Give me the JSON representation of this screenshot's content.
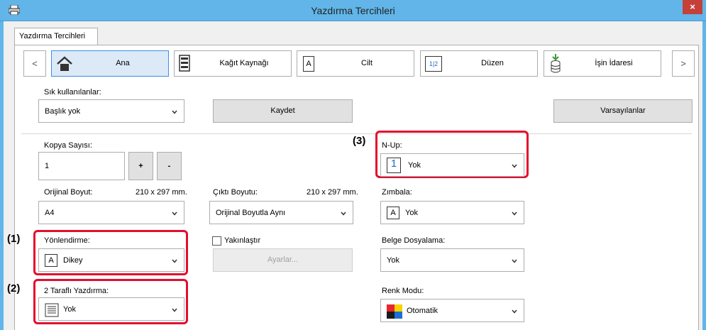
{
  "window": {
    "title": "Yazdırma Tercihleri",
    "close_glyph": "×"
  },
  "tab": {
    "label": "Yazdırma Tercihleri"
  },
  "nav": {
    "prev": "<",
    "next": ">",
    "items": [
      {
        "label": "Ana",
        "icon": "home-icon"
      },
      {
        "label": "Kağıt Kaynağı",
        "icon": "paper-tray-icon"
      },
      {
        "label": "Cilt",
        "icon": "binding-icon",
        "icon_text": "A"
      },
      {
        "label": "Düzen",
        "icon": "layout-icon",
        "icon_text": "1|2"
      },
      {
        "label": "İşin İdaresi",
        "icon": "job-handling-icon"
      }
    ]
  },
  "favorites": {
    "label": "Sık kullanılanlar:",
    "value": "Başlık yok",
    "save": "Kaydet",
    "defaults": "Varsayılanlar"
  },
  "copies": {
    "label": "Kopya Sayısı:",
    "value": "1",
    "plus": "+",
    "minus": "-"
  },
  "original_size": {
    "label": "Orijinal Boyut:",
    "dims": "210 x 297 mm.",
    "value": "A4"
  },
  "output_size": {
    "label": "Çıktı Boyutu:",
    "dims": "210 x 297 mm.",
    "value": "Orijinal Boyutla Aynı"
  },
  "orientation": {
    "label": "Yönlendirme:",
    "value": "Dikey",
    "icon_text": "A"
  },
  "zoom": {
    "label": "Yakınlaştır",
    "settings": "Ayarlar..."
  },
  "duplex": {
    "label": "2 Taraflı Yazdırma:",
    "value": "Yok"
  },
  "nup": {
    "label": "N-Up:",
    "value": "Yok",
    "icon_text": "1"
  },
  "staple": {
    "label": "Zımbala:",
    "value": "Yok",
    "icon_text": "A"
  },
  "filing": {
    "label": "Belge Dosyalama:",
    "value": "Yok"
  },
  "color_mode": {
    "label": "Renk Modu:",
    "value": "Otomatik"
  },
  "callouts": {
    "c1": "(1)",
    "c2": "(2)",
    "c3": "(3)"
  },
  "colors": {
    "titlebar": "#61b5e8",
    "highlight": "#e30e2e",
    "active_tab": "#dce9f7"
  }
}
